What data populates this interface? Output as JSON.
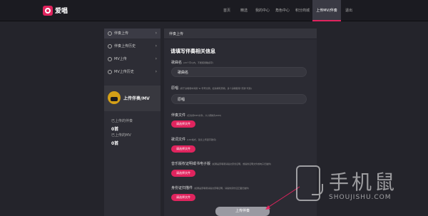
{
  "brand": "爱唱",
  "nav": [
    {
      "label": "首页"
    },
    {
      "label": "精选"
    },
    {
      "label": "我的中心"
    },
    {
      "label": "角色中心"
    },
    {
      "label": "积分商城"
    },
    {
      "label": "上传MV/伴奏"
    },
    {
      "label": "退出"
    }
  ],
  "sidebar": {
    "items": [
      {
        "label": "伴奏上传"
      },
      {
        "label": "伴奏上传历史"
      },
      {
        "label": "MV上传"
      },
      {
        "label": "MV上传历史"
      }
    ],
    "upload_label": "上传伴奏/MV",
    "stats": [
      {
        "label": "已上传的伴奏",
        "value": "0首"
      },
      {
        "label": "已上传的MV",
        "value": "0首"
      }
    ]
  },
  "main": {
    "header": "伴奏上传",
    "title": "请填写伴奏相关信息",
    "song_name": {
      "label": "歌曲名",
      "hint": "(20个字以内，不能使用敏感字)",
      "value": "歌曲名"
    },
    "singer": {
      "label": "原唱",
      "hint": "(用于演唱者中间用“&”符号分隔，如请填写原唱，多个演唱者用“普通”代替)",
      "value": "原唱"
    },
    "accompaniment_file": {
      "label": "伴奏文件",
      "hint": "(仅支持MP3文件，大小限制为20M)",
      "button": "请选择文件"
    },
    "lyric_file": {
      "label": "歌词文件",
      "hint": "(LRC格式，建议上传逐字歌词)",
      "button": "请选择文件"
    },
    "copyright_file": {
      "label": "音乐版权证明或书电子版",
      "hint": "(如果是原唱者请提交原创证明，或提供证明文件或电子扫描件)",
      "button": "请选择文件"
    },
    "id_file": {
      "label": "身份证扫描件",
      "hint": "(如果是原唱者请提交原唱证明，请提供身份证正面扫描件)",
      "button": "请选择文件"
    },
    "submit": "上传伴奏"
  },
  "watermark": {
    "title": "手机鼠",
    "url": "SHOUJISHU.COM"
  },
  "colors": {
    "accent": "#e0245e",
    "background": "#24242b",
    "topbar": "#1b1b21"
  }
}
